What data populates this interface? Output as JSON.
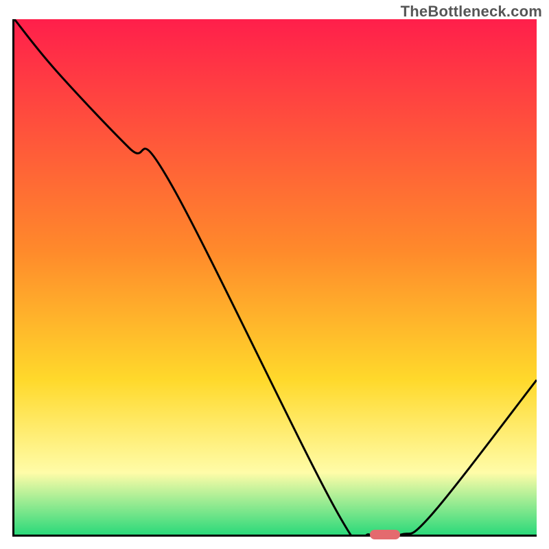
{
  "watermark": "TheBottleneck.com",
  "colors": {
    "gradient_top": "#ff1f4b",
    "gradient_mid1": "#ff8a2b",
    "gradient_mid2": "#ffd92b",
    "gradient_mid3": "#fffca8",
    "gradient_bottom": "#2bd97a",
    "curve": "#000000",
    "marker": "#e46a6e",
    "axis": "#000000"
  },
  "chart_data": {
    "type": "line",
    "title": "",
    "xlabel": "",
    "ylabel": "",
    "xlim": [
      0,
      100
    ],
    "ylim": [
      0,
      100
    ],
    "grid": false,
    "legend": false,
    "annotations": [
      {
        "text": "TheBottleneck.com",
        "position": "top-right"
      }
    ],
    "series": [
      {
        "name": "bottleneck-curve",
        "x": [
          0,
          8,
          22,
          30,
          62,
          68,
          74,
          80,
          100
        ],
        "values": [
          100,
          90,
          75,
          68,
          4,
          0,
          0,
          4,
          30
        ]
      }
    ],
    "marker": {
      "x_range": [
        68,
        74
      ],
      "y": 0,
      "color": "#e46a6e"
    },
    "background_gradient": {
      "stops": [
        {
          "pct": 0,
          "color": "#ff1f4b"
        },
        {
          "pct": 45,
          "color": "#ff8a2b"
        },
        {
          "pct": 70,
          "color": "#ffd92b"
        },
        {
          "pct": 88,
          "color": "#fffca8"
        },
        {
          "pct": 100,
          "color": "#2bd97a"
        }
      ]
    }
  }
}
